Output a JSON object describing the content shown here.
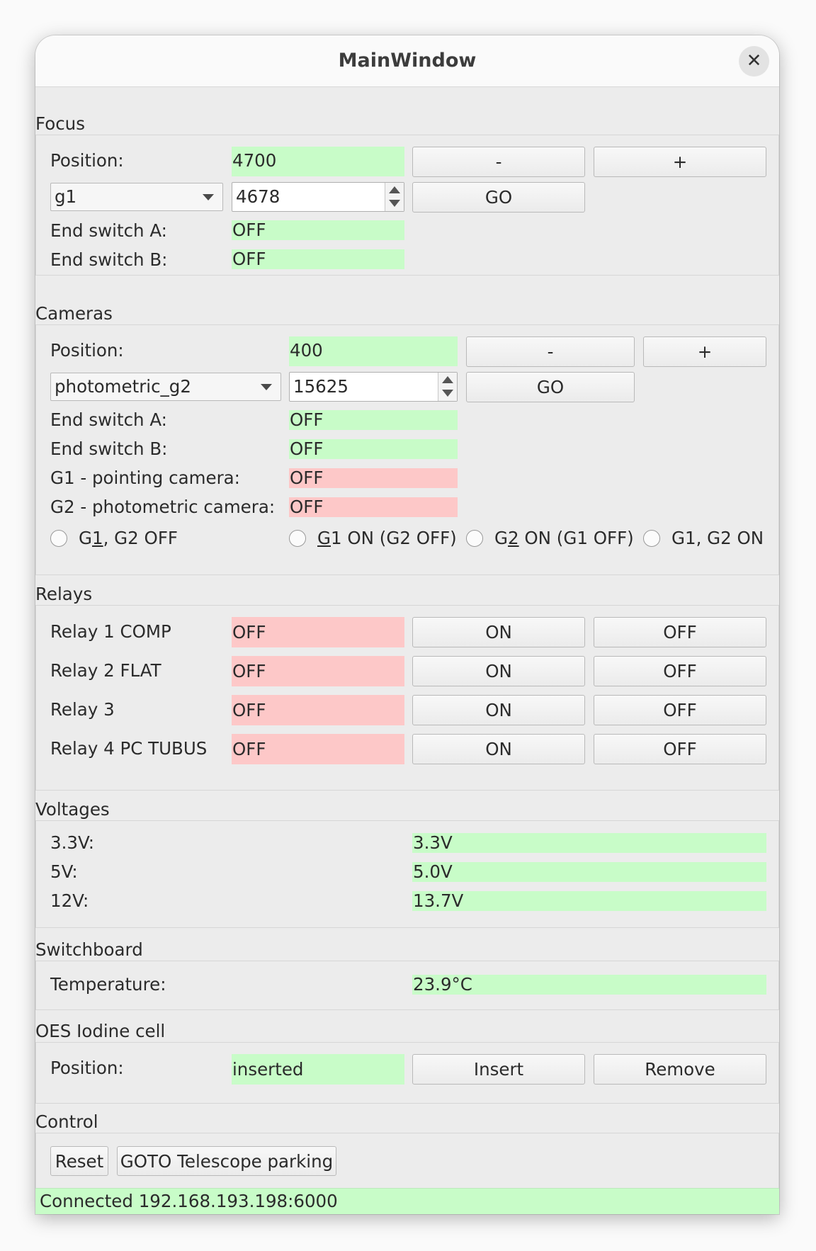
{
  "window": {
    "title": "MainWindow"
  },
  "focus": {
    "section_title": "Focus",
    "position_label": "Position:",
    "position_value": "4700",
    "minus_label": "-",
    "plus_label": "+",
    "preset_selected": "g1",
    "target_value": "4678",
    "go_label": "GO",
    "end_a_label": "End switch A:",
    "end_a_value": "OFF",
    "end_b_label": "End switch B:",
    "end_b_value": "OFF"
  },
  "cameras": {
    "section_title": "Cameras",
    "position_label": "Position:",
    "position_value": "400",
    "minus_label": "-",
    "plus_label": "+",
    "preset_selected": "photometric_g2",
    "target_value": "15625",
    "go_label": "GO",
    "end_a_label": "End switch A:",
    "end_a_value": "OFF",
    "end_b_label": "End switch B:",
    "end_b_value": "OFF",
    "g1_label": "G1 - pointing camera:",
    "g1_value": "OFF",
    "g2_label": "G2 - photometric camera:",
    "g2_value": "OFF",
    "radios": [
      {
        "pre": "G",
        "mn": "1",
        "post": ", G2 OFF"
      },
      {
        "pre": "",
        "mn": "G",
        "post": "1 ON (G2 OFF)"
      },
      {
        "pre": "G",
        "mn": "2",
        "post": " ON (G1 OFF)"
      },
      {
        "pre": "",
        "mn": "",
        "post": "G1, G2 ON"
      }
    ]
  },
  "relays": {
    "section_title": "Relays",
    "on_label": "ON",
    "off_label": "OFF",
    "items": [
      {
        "label": "Relay 1 COMP",
        "value": "OFF"
      },
      {
        "label": "Relay 2 FLAT",
        "value": "OFF"
      },
      {
        "label": "Relay 3",
        "value": "OFF"
      },
      {
        "label": "Relay 4 PC TUBUS",
        "value": "OFF"
      }
    ]
  },
  "voltages": {
    "section_title": "Voltages",
    "items": [
      {
        "label": "3.3V:",
        "value": "3.3V"
      },
      {
        "label": "5V:",
        "value": "5.0V"
      },
      {
        "label": "12V:",
        "value": "13.7V"
      }
    ]
  },
  "switchboard": {
    "section_title": "Switchboard",
    "temperature_label": "Temperature:",
    "temperature_value": "23.9°C"
  },
  "iodine": {
    "section_title": "OES Iodine cell",
    "position_label": "Position:",
    "position_value": "inserted",
    "insert_label": "Insert",
    "remove_label": "Remove"
  },
  "control": {
    "section_title": "Control",
    "reset_label": "Reset",
    "parking_label": "GOTO Telescope parking"
  },
  "status_bar": {
    "text": "Connected 192.168.193.198:6000"
  },
  "colors": {
    "ok": "#c8fcc8",
    "alert": "#fdc8c8"
  }
}
